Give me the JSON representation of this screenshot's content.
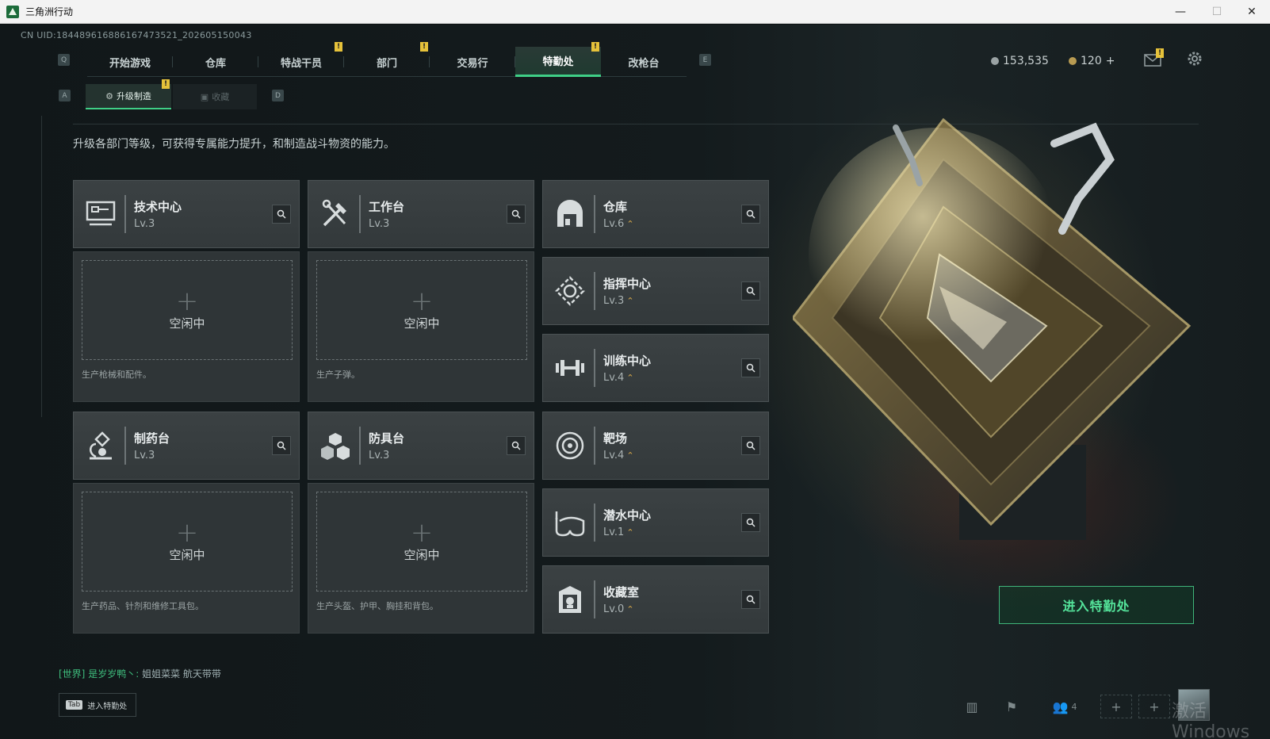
{
  "window": {
    "title": "三角洲行动",
    "minimize": "—",
    "maximize": "☐",
    "close": "✕"
  },
  "uid": "CN UID:18448961688616747352​1_202605150043",
  "hotkeys": {
    "q": "Q",
    "e": "E",
    "a": "A",
    "d": "D"
  },
  "nav": {
    "tabs": [
      {
        "label": "开始游戏"
      },
      {
        "label": "仓库"
      },
      {
        "label": "特战干员",
        "badge": "!"
      },
      {
        "label": "部门",
        "badge": "!"
      },
      {
        "label": "交易行"
      },
      {
        "label": "特勤处",
        "badge": "!",
        "active": true
      },
      {
        "label": "改枪台"
      }
    ]
  },
  "currency": {
    "silver": "153,535",
    "gold": "120",
    "gold_add": "+",
    "mail_badge": "!"
  },
  "subtabs": [
    {
      "label": "升级制造",
      "active": true,
      "badge": "!"
    },
    {
      "label": "收藏"
    }
  ],
  "description": "升级各部门等级，可获得专属能力提升，和制造战斗物资的能力。",
  "stations": [
    {
      "name": "技术中心",
      "level": "Lv.3",
      "icon": "computer-icon",
      "slot": "空闲中",
      "caption": "生产枪械和配件。"
    },
    {
      "name": "工作台",
      "level": "Lv.3",
      "icon": "tools-icon",
      "slot": "空闲中",
      "caption": "生产子弹。"
    },
    {
      "name": "制药台",
      "level": "Lv.3",
      "icon": "microscope-icon",
      "slot": "空闲中",
      "caption": "生产药品、针剂和维修工具包。"
    },
    {
      "name": "防具台",
      "level": "Lv.3",
      "icon": "armor-boxes-icon",
      "slot": "空闲中",
      "caption": "生产头盔、护甲、胸挂和背包。"
    }
  ],
  "departments": [
    {
      "name": "仓库",
      "level": "Lv.6",
      "icon": "storage-icon",
      "upgrade": true
    },
    {
      "name": "指挥中心",
      "level": "Lv.3",
      "icon": "command-icon",
      "upgrade": true
    },
    {
      "name": "训练中心",
      "level": "Lv.4",
      "icon": "dumbbell-icon",
      "upgrade": true
    },
    {
      "name": "靶场",
      "level": "Lv.4",
      "icon": "target-icon",
      "upgrade": true
    },
    {
      "name": "潜水中心",
      "level": "Lv.1",
      "icon": "diving-mask-icon",
      "upgrade": true
    },
    {
      "name": "收藏室",
      "level": "Lv.0",
      "icon": "collection-icon",
      "upgrade": true
    }
  ],
  "enter_button": "进入特勤处",
  "chat": {
    "channel": "[世界]",
    "sender": "是岁岁鸭丶:",
    "message": "姐姐菜菜 航天带带"
  },
  "tab_hint": {
    "key": "Tab",
    "label": "进入特勤处"
  },
  "friends_count": "4",
  "watermark": "激活 Windows",
  "colors": {
    "accent": "#3fcf86",
    "badge": "#e6c23a",
    "upgrade": "#d8a94a"
  }
}
